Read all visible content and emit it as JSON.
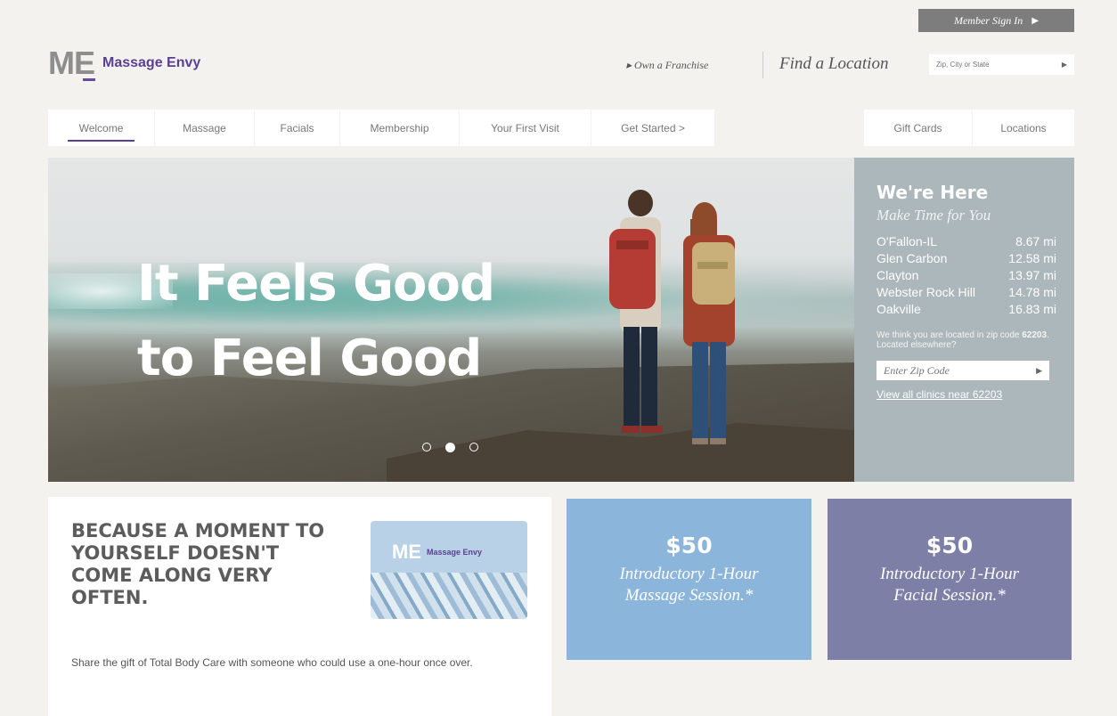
{
  "header": {
    "member_signin": "Member Sign In",
    "brand_mark": "ME",
    "brand_name": "Massage Envy",
    "franchise_link": "Own a Franchise",
    "find_location": "Find a Location",
    "zip_placeholder": "Zip, City or State"
  },
  "nav": {
    "left": [
      "Welcome",
      "Massage",
      "Facials",
      "Membership",
      "Your First Visit",
      "Get Started >"
    ],
    "right": [
      "Gift Cards",
      "Locations"
    ],
    "active": "Welcome"
  },
  "hero": {
    "line1": "It Feels Good",
    "line2": "to Feel Good",
    "slides": 3,
    "active_slide": 2
  },
  "locator": {
    "title": "We're Here",
    "subtitle": "Make Time for You",
    "locations": [
      {
        "name": "O'Fallon-IL",
        "distance": "8.67 mi"
      },
      {
        "name": "Glen Carbon",
        "distance": "12.58 mi"
      },
      {
        "name": "Clayton",
        "distance": "13.97 mi"
      },
      {
        "name": "Webster Rock Hill",
        "distance": "14.78 mi"
      },
      {
        "name": "Oakville",
        "distance": "16.83 mi"
      }
    ],
    "note_prefix": "We think you are located in zip code ",
    "note_zip": "62203",
    "note_suffix": ". Located elsewhere?",
    "zip_placeholder": "Enter Zip Code",
    "view_all": "View all clinics near 62203"
  },
  "promo": {
    "heading": "BECAUSE A MOMENT TO YOURSELF DOESN'T COME ALONG VERY OFTEN.",
    "text": "Share the gift of Total Body Care with someone who could use a one-hour once over.",
    "card_mark": "ME",
    "card_name": "Massage Envy"
  },
  "offers": [
    {
      "price": "$50",
      "line1": "Introductory 1-Hour",
      "line2": "Massage Session.*",
      "color": "#8cb5dc"
    },
    {
      "price": "$50",
      "line1": "Introductory 1-Hour",
      "line2": "Facial Session.*",
      "color": "#7d7fa6"
    }
  ],
  "colors": {
    "brand_purple": "#5a3f93",
    "locator_panel": "#abb7bb",
    "member_button": "#7d7d7d"
  }
}
